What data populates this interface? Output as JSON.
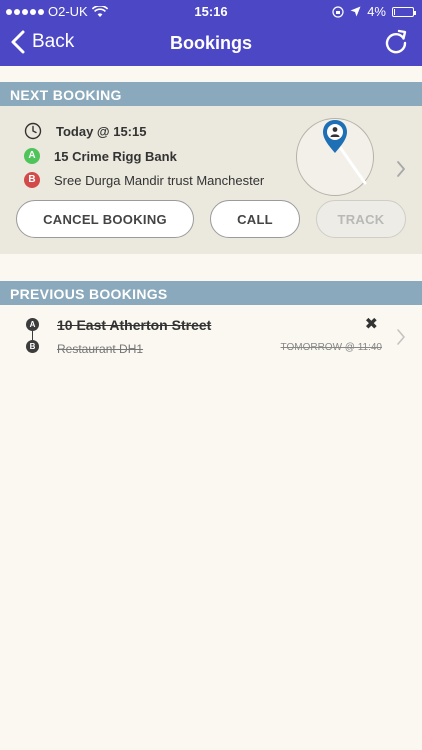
{
  "status_bar": {
    "carrier": "O2-UK",
    "time": "15:16",
    "battery": "4%",
    "battery_level": 0.04
  },
  "nav": {
    "back_label": "Back",
    "title": "Bookings"
  },
  "next_booking": {
    "header": "NEXT BOOKING",
    "when": "Today @ 15:15",
    "pickup_marker": "A",
    "pickup": "15 Crime Rigg Bank",
    "dropoff_marker": "B",
    "dropoff": "Sree Durga Mandir trust Manchester",
    "buttons": {
      "cancel": "CANCEL BOOKING",
      "call": "CALL",
      "track": "TRACK"
    }
  },
  "previous_bookings": {
    "header": "PREVIOUS BOOKINGS",
    "items": [
      {
        "pickup_marker": "A",
        "dropoff_marker": "B",
        "pickup": "10 East Atherton Street",
        "dropoff": "Restaurant DH1",
        "when": "TOMORROW @ 11:40"
      }
    ]
  },
  "colors": {
    "header_bg": "#4c47c4",
    "section_bg": "#8aa9bc",
    "pin_a": "#4fc45a",
    "pin_b": "#d24a4a"
  }
}
